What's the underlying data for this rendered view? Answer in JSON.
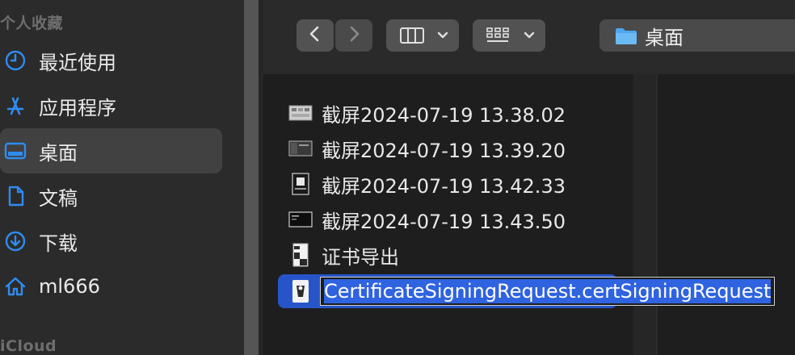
{
  "sidebar": {
    "favorites_header": "个人收藏",
    "items": [
      {
        "label": "最近使用",
        "icon": "clock-icon"
      },
      {
        "label": "应用程序",
        "icon": "app-store-icon"
      },
      {
        "label": "桌面",
        "icon": "desktop-icon"
      },
      {
        "label": "文稿",
        "icon": "document-icon"
      },
      {
        "label": "下载",
        "icon": "download-icon"
      },
      {
        "label": "ml666",
        "icon": "home-icon"
      }
    ],
    "selected_index": 2,
    "icloud_header": "iCloud"
  },
  "toolbar": {
    "back_icon": "chevron-left-icon",
    "forward_icon": "chevron-right-icon",
    "view_icon": "column-view-icon",
    "group_icon": "grid-view-icon",
    "location": "桌面"
  },
  "files": [
    {
      "name": "截屏2024-07-19 13.38.02",
      "icon": "screenshot-thumbnail-icon"
    },
    {
      "name": "截屏2024-07-19 13.39.20",
      "icon": "screenshot-thumbnail-icon"
    },
    {
      "name": "截屏2024-07-19 13.42.33",
      "icon": "screenshot-thumbnail-icon"
    },
    {
      "name": "截屏2024-07-19 13.43.50",
      "icon": "screenshot-thumbnail-icon"
    },
    {
      "name": "证书导出",
      "icon": "zip-file-icon"
    },
    {
      "name": "CertificateSigningRequest.certSigningRequest",
      "icon": "certificate-request-icon",
      "selected": true,
      "renaming": true
    }
  ],
  "colors": {
    "accent": "#2f6fd9",
    "selection": "#2755c9",
    "sidebar_bg": "#2b2b2b",
    "content_bg": "#1e1e1e"
  }
}
